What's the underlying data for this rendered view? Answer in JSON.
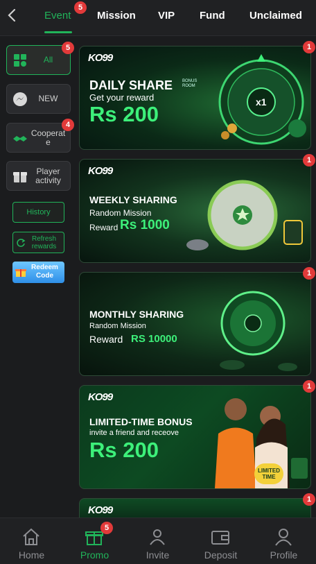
{
  "header": {
    "tabs": [
      {
        "label": "Event",
        "badge": "5",
        "active": true
      },
      {
        "label": "Mission"
      },
      {
        "label": "VIP"
      },
      {
        "label": "Fund"
      },
      {
        "label": "Unclaimed"
      }
    ]
  },
  "sidebar": {
    "items": [
      {
        "label": "All",
        "badge": "5",
        "active": true
      },
      {
        "label": "NEW"
      },
      {
        "label": "Cooperate",
        "badge": "4"
      },
      {
        "label": "Player activity"
      }
    ],
    "history_label": "History",
    "refresh_label": "Refresh rewards",
    "redeem_label": "Redeem Code"
  },
  "banners": [
    {
      "badge": "1",
      "logo": "KO99",
      "title": "DAILY SHARE",
      "sub": "Get your reward",
      "amount": "Rs 200",
      "wheel_center": "x1",
      "room_label": "BONUS ROOM"
    },
    {
      "badge": "1",
      "logo": "KO99",
      "title": "WEEKLY SHARING",
      "sub": "Random Mission",
      "reward_prefix": "Reward",
      "amount": "Rs 1000"
    },
    {
      "badge": "1",
      "title": "MONTHLY SHARING",
      "sub": "Random Mission",
      "reward_prefix": "Reward",
      "amount": "RS 10000"
    },
    {
      "badge": "1",
      "logo": "KO99",
      "title": "LIMITED-TIME BONUS",
      "sub": "invite a friend and receove",
      "amount": "Rs 200",
      "tag": "LIMITED TIME"
    },
    {
      "badge": "1",
      "logo": "KO99"
    }
  ],
  "bottom_nav": [
    {
      "label": "Home"
    },
    {
      "label": "Promo",
      "badge": "5",
      "active": true
    },
    {
      "label": "Invite"
    },
    {
      "label": "Deposit"
    },
    {
      "label": "Profile"
    }
  ],
  "colors": {
    "accent": "#21b45a",
    "badge": "#e23a3a",
    "background": "#1b1c1e"
  }
}
